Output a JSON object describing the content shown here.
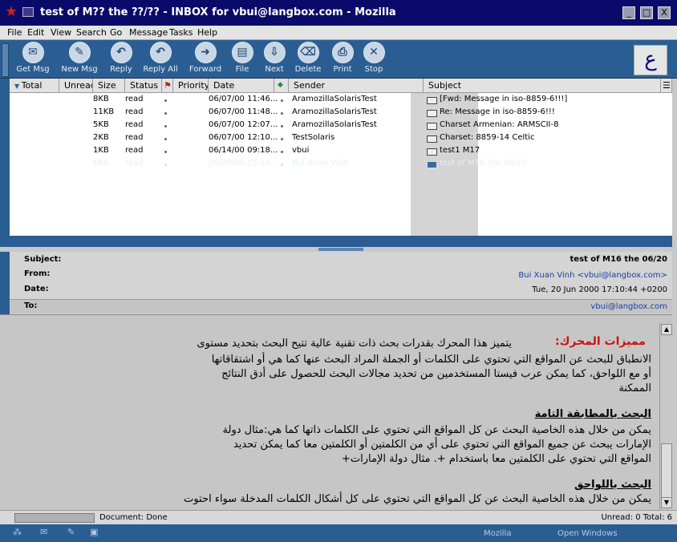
{
  "window": {
    "title": "test of M?? the ??/?? - INBOX for vbui@langbox.com - Mozilla",
    "minimize": "_",
    "maximize": "□",
    "close": "X"
  },
  "menu": [
    "File",
    "Edit",
    "View",
    "Search",
    "Go",
    "Message",
    "Tasks",
    "Help"
  ],
  "toolbar": [
    {
      "label": "Get Msg",
      "icon": "get-msg-icon",
      "glyph": "✉"
    },
    {
      "label": "New Msg",
      "icon": "new-msg-icon",
      "glyph": "✎"
    },
    {
      "label": "Reply",
      "icon": "reply-icon",
      "glyph": "↶"
    },
    {
      "label": "Reply All",
      "icon": "reply-all-icon",
      "glyph": "↶"
    },
    {
      "label": "Forward",
      "icon": "forward-icon",
      "glyph": "➜"
    },
    {
      "label": "File",
      "icon": "file-icon",
      "glyph": "▤"
    },
    {
      "label": "Next",
      "icon": "next-icon",
      "glyph": "⇩"
    },
    {
      "label": "Delete",
      "icon": "delete-icon",
      "glyph": "⌫"
    },
    {
      "label": "Print",
      "icon": "print-icon",
      "glyph": "⎙"
    },
    {
      "label": "Stop",
      "icon": "stop-icon",
      "glyph": "✕"
    }
  ],
  "logo_glyph": "ع",
  "columns": [
    "Total",
    "Unread",
    "Size",
    "Status",
    "Priority",
    "Date",
    "Sender",
    "Subject"
  ],
  "messages": [
    {
      "size": "8KB",
      "status": "read",
      "date": "06/07/00 11:46...",
      "sender": "AramozillaSolarisTest",
      "subject": "[Fwd: Message in iso-8859-6!!!]",
      "selected": false
    },
    {
      "size": "11KB",
      "status": "read",
      "date": "06/07/00 11:48...",
      "sender": "AramozillaSolarisTest",
      "subject": "Re: Message in iso-8859-6!!!",
      "selected": false
    },
    {
      "size": "5KB",
      "status": "read",
      "date": "06/07/00 12:07...",
      "sender": "AramozillaSolarisTest",
      "subject": "Charset  Armenian: ARMSCII-8",
      "selected": false
    },
    {
      "size": "2KB",
      "status": "read",
      "date": "06/07/00 12:10...",
      "sender": "TestSolaris",
      "subject": "Charset: 8859-14 Celtic",
      "selected": false
    },
    {
      "size": "1KB",
      "status": "read",
      "date": "06/14/00 09:18...",
      "sender": "vbui",
      "subject": "test1 M17",
      "selected": false
    },
    {
      "size": "6KB",
      "status": "read",
      "date": "06/20/00 05:10...",
      "sender": "Bui Xuan Vinh",
      "subject": "test of M16 the 06/20",
      "selected": true
    }
  ],
  "header": {
    "subject_label": "Subject:",
    "subject": "test of M16 the 06/20",
    "from_label": "From:",
    "from": "Bui Xuan Vinh <vbui@langbox.com>",
    "date_label": "Date:",
    "date": "Tue, 20 Jun 2000 17:10:44 +0200",
    "to_label": "To:",
    "to": "vbui@langbox.com"
  },
  "body_lines": [
    {
      "text": "مميزات المحرك:   يتميز هذا المحرك بقدرات بحث ذات تقنية عالية تتيح البحث بتحديد مستوى",
      "style": "mixed"
    },
    {
      "text": "الانطباق للبحث عن المواقع التي تحتوي على الكلمات أو الجملة المراد البحث عنها كما هي أو اشتقاقاتها",
      "style": "normal"
    },
    {
      "text": "أو مع اللواحق، كما يمكن عرب فيستا المستخدمين من تحديد مجالات البحث للحصول على أدق النتائج",
      "style": "normal"
    },
    {
      "text": "الممكنة",
      "style": "normal"
    },
    {
      "text": "البحث بالمطابقة التامة",
      "style": "heading"
    },
    {
      "text": "يمكن من خلال هذه الخاصية البحث عن كل المواقع التي تحتوي على الكلمات ذاتها كما هي:مثال دولة",
      "style": "normal"
    },
    {
      "text": "الإمارات يبحث عن جميع المواقع التي تحتوي على أي من الكلمتين أو الكلمتين معا كما يمكن تحديد",
      "style": "normal"
    },
    {
      "text": "المواقع التي تحتوي على الكلمتين معا باستخدام +. مثال دولة الإمارات+",
      "style": "normal"
    },
    {
      "text": "البحث باللواحق",
      "style": "heading"
    },
    {
      "text": "يمكن من خلال هذه الخاصية البحث عن كل المواقع التي تحتوي على كل أشكال الكلمات المدخلة سواء احتوت",
      "style": "normal"
    }
  ],
  "body_title": "مميزات المحرك:",
  "body_first": "يتميز هذا المحرك بقدرات بحث ذات تقنية عالية تتيح البحث بتحديد مستوى",
  "status": {
    "text": "Document: Done",
    "counts": "Unread: 0 Total: 6"
  },
  "taskbar": {
    "mozilla": "Mozilla",
    "open_windows": "Open Windows"
  }
}
